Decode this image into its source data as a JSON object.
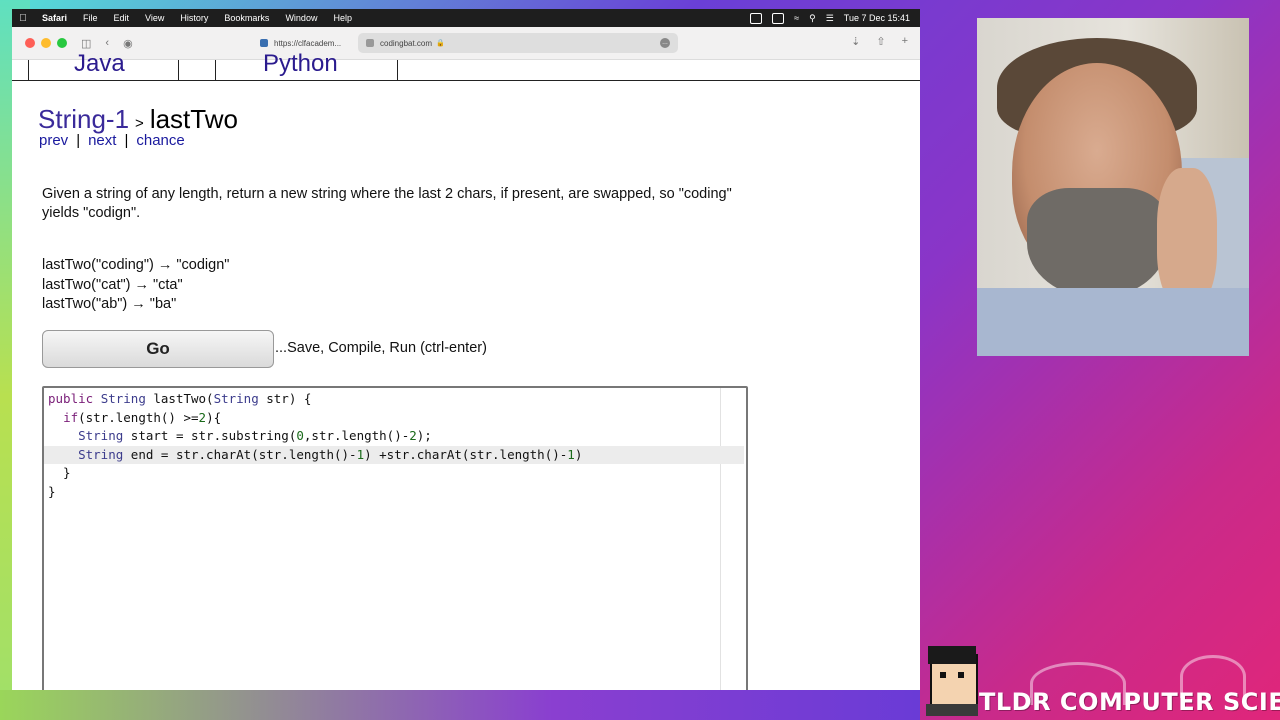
{
  "menubar": {
    "app": "Safari",
    "items": [
      "File",
      "Edit",
      "View",
      "History",
      "Bookmarks",
      "Window",
      "Help"
    ],
    "clock": "Tue 7 Dec  15:41"
  },
  "browser": {
    "tabs": [
      {
        "title": "https://clfacadem..."
      },
      {
        "title": "codingbat.com"
      }
    ]
  },
  "page": {
    "lang_tabs": [
      "Java",
      "Python"
    ],
    "breadcrumb": {
      "section": "String-1",
      "separator": ">",
      "problem": "lastTwo"
    },
    "nav": {
      "prev": "prev",
      "next": "next",
      "chance": "chance",
      "sep": "|"
    },
    "description": "Given a string of any length, return a new string where the last 2 chars, if present, are swapped, so \"coding\" yields \"codign\".",
    "examples": [
      "lastTwo(\"coding\") → \"codign\"",
      "lastTwo(\"cat\") → \"cta\"",
      "lastTwo(\"ab\") → \"ba\""
    ],
    "go_label": "Go",
    "go_hint": "...Save, Compile, Run (ctrl-enter)"
  },
  "editor": {
    "lines": [
      "public String lastTwo(String str) {",
      "  if(str.length() >=2){",
      "    String start = str.substring(0,str.length()-2);",
      "    String end = str.charAt(str.length()-1) +str.charAt(str.length()-1)",
      "  }",
      "}"
    ],
    "highlighted_line": 4
  },
  "branding": {
    "text": "TLDR COMPUTER SCIENCE"
  }
}
